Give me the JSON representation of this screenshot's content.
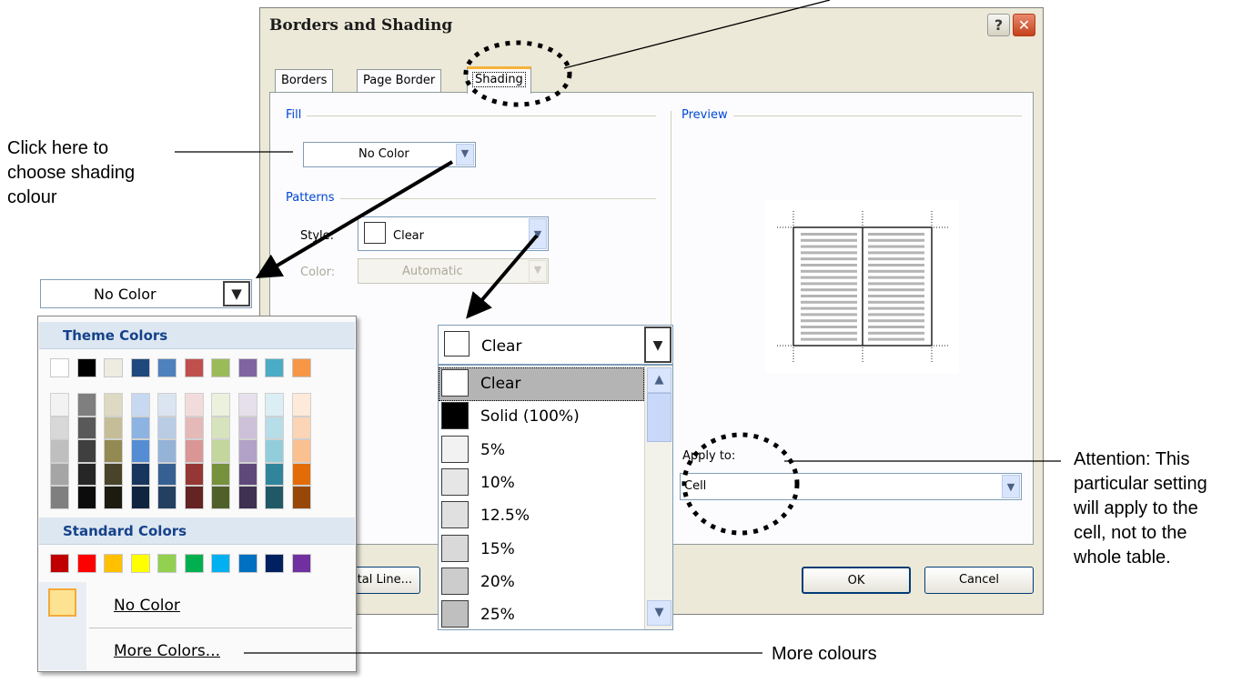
{
  "annotations": {
    "choose_shading": [
      "Click here to",
      "choose shading",
      "colour"
    ],
    "attention": [
      "Attention: This",
      "particular setting",
      "will apply to the",
      "cell, not to the",
      "whole table."
    ],
    "more_colours": "More colours"
  },
  "dialog": {
    "title": "Borders and Shading",
    "help": "?",
    "close": "✕",
    "tabs": [
      "Borders",
      "Page Border",
      "Shading"
    ],
    "active_tab": "Shading",
    "fill_label": "Fill",
    "fill_value": "No Color",
    "patterns_label": "Patterns",
    "style_label": "Style:",
    "style_value": "Clear",
    "color_label": "Color:",
    "color_value": "Automatic",
    "preview_label": "Preview",
    "apply_to_label": "Apply to:",
    "apply_to_value": "Cell",
    "horizontal_line_button": "Horizontal Line...",
    "ok_button": "OK",
    "cancel_button": "Cancel"
  },
  "color_picker": {
    "value": "No Color",
    "theme_header": "Theme Colors",
    "standard_header": "Standard Colors",
    "theme_base": [
      "#ffffff",
      "#000000",
      "#eeece1",
      "#1f497d",
      "#4f81bd",
      "#c0504d",
      "#9bbb59",
      "#8064a2",
      "#4bacc6",
      "#f79646"
    ],
    "theme_tints": [
      [
        "#f2f2f2",
        "#d8d8d8",
        "#bfbfbf",
        "#a5a5a5",
        "#7f7f7f"
      ],
      [
        "#7f7f7f",
        "#595959",
        "#3f3f3f",
        "#262626",
        "#0c0c0c"
      ],
      [
        "#ddd9c3",
        "#c4bd97",
        "#938953",
        "#494429",
        "#1d1b10"
      ],
      [
        "#c6d9f0",
        "#8db3e2",
        "#548dd4",
        "#17365d",
        "#0f243e"
      ],
      [
        "#dbe5f1",
        "#b8cce4",
        "#95b3d7",
        "#366092",
        "#244061"
      ],
      [
        "#f2dcdb",
        "#e5b9b7",
        "#d99694",
        "#953734",
        "#632423"
      ],
      [
        "#ebf1dd",
        "#d7e3bc",
        "#c3d69b",
        "#76923c",
        "#4f6128"
      ],
      [
        "#e5e0ec",
        "#ccc1d9",
        "#b2a2c7",
        "#5f497a",
        "#3f3151"
      ],
      [
        "#dbeef3",
        "#b7dde8",
        "#92cddc",
        "#31859b",
        "#205867"
      ],
      [
        "#fdeada",
        "#fbd5b5",
        "#fac08f",
        "#e36c09",
        "#974806"
      ]
    ],
    "standard": [
      "#c00000",
      "#ff0000",
      "#ffc000",
      "#ffff00",
      "#92d050",
      "#00b050",
      "#00b0f0",
      "#0070c0",
      "#002060",
      "#7030a0"
    ],
    "no_color": "No Color",
    "more_colors": "More Colors..."
  },
  "pattern_dropdown": {
    "value": "Clear",
    "options": [
      {
        "label": "Clear",
        "fill": "#ffffff"
      },
      {
        "label": "Solid (100%)",
        "fill": "#000000"
      },
      {
        "label": "5%",
        "fill": "#f2f2f2"
      },
      {
        "label": "10%",
        "fill": "#e6e6e6"
      },
      {
        "label": "12.5%",
        "fill": "#e0e0e0"
      },
      {
        "label": "15%",
        "fill": "#d9d9d9"
      },
      {
        "label": "20%",
        "fill": "#cccccc"
      },
      {
        "label": "25%",
        "fill": "#bfbfbf"
      }
    ],
    "selected": "Clear"
  }
}
